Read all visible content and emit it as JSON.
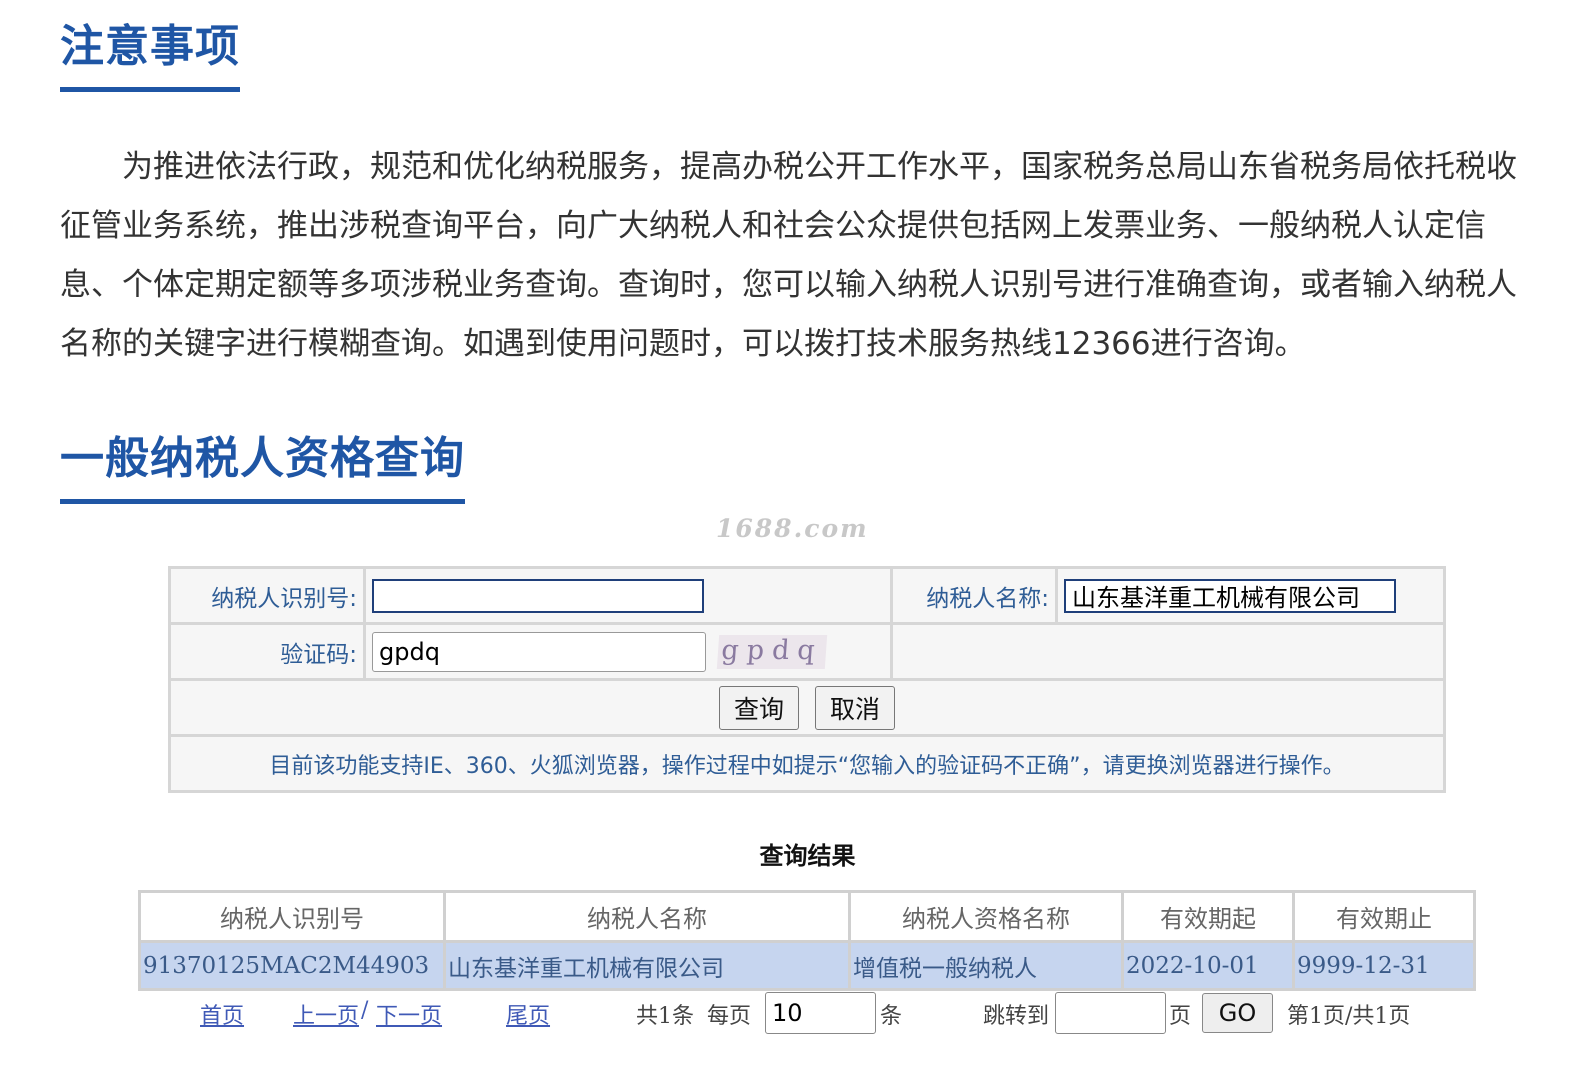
{
  "notice_section": {
    "title": "注意事项",
    "body": "为推进依法行政，规范和优化纳税服务，提高办税公开工作水平，国家税务总局山东省税务局依托税收征管业务系统，推出涉税查询平台，向广大纳税人和社会公众提供包括网上发票业务、一般纳税人认定信息、个体定期定额等多项涉税业务查询。查询时，您可以输入纳税人识别号进行准确查询，或者输入纳税人名称的关键字进行模糊查询。如遇到使用问题时，可以拨打技术服务热线12366进行咨询。"
  },
  "query_section": {
    "title": "一般纳税人资格查询",
    "watermark": "1688.com"
  },
  "form": {
    "taxpayer_id_label": "纳税人识别号:",
    "taxpayer_id_value": "",
    "taxpayer_name_label": "纳税人名称:",
    "taxpayer_name_value": "山东基洋重工机械有限公司",
    "captcha_label": "验证码:",
    "captcha_value": "gpdq",
    "captcha_image_text": "gpdq",
    "query_button": "查询",
    "cancel_button": "取消",
    "browser_notice": "目前该功能支持IE、360、火狐浏览器，操作过程中如提示“您输入的验证码不正确”，请更换浏览器进行操作。"
  },
  "results": {
    "title": "查询结果",
    "columns": [
      "纳税人识别号",
      "纳税人名称",
      "纳税人资格名称",
      "有效期起",
      "有效期止"
    ],
    "rows": [
      [
        "91370125MAC2M44903",
        "山东基洋重工机械有限公司",
        "增值税一般纳税人",
        "2022-10-01",
        "9999-12-31"
      ]
    ]
  },
  "pager": {
    "first": "首页",
    "prev": "上一页",
    "separator": "/",
    "next": "下一页",
    "last": "尾页",
    "total": "共1条",
    "per_page_label": "每页",
    "per_page_value": "10",
    "per_page_unit": "条",
    "jump_label": "跳转到",
    "jump_value": "",
    "jump_unit": "页",
    "go_button": "GO",
    "page_info": "第1页/共1页"
  },
  "colors": {
    "heading_blue": "#1f56a5",
    "label_blue": "#2f5d96",
    "row_highlight": "#c6d5ef",
    "link_blue": "#3f59b6"
  }
}
